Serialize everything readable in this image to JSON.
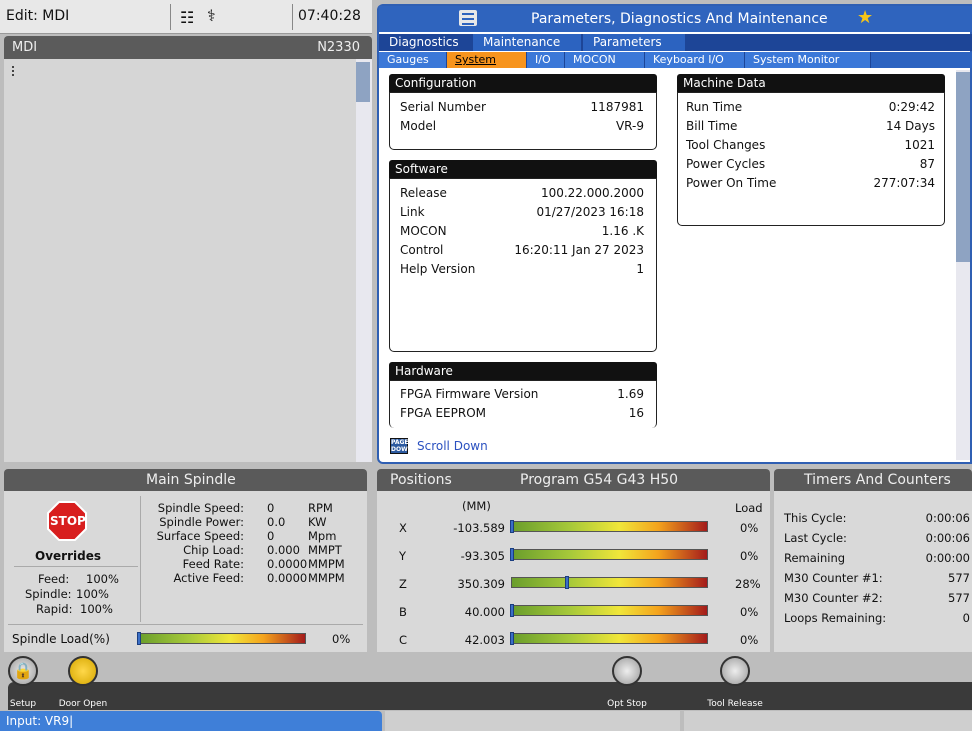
{
  "topbar": {
    "mode": "Edit: MDI",
    "clock": "07:40:28"
  },
  "mdi": {
    "title": "MDI",
    "n_number": "N2330"
  },
  "param": {
    "title": "Parameters, Diagnostics And Maintenance",
    "tabs1": [
      "Diagnostics",
      "Maintenance",
      "Parameters"
    ],
    "tabs2": [
      "Gauges",
      "System",
      "I/O",
      "MOCON",
      "Keyboard I/O",
      "System Monitor"
    ],
    "configuration": {
      "header": "Configuration",
      "rows": [
        {
          "label": "Serial Number",
          "value": "1187981"
        },
        {
          "label": "Model",
          "value": "VR-9"
        }
      ]
    },
    "software": {
      "header": "Software",
      "rows": [
        {
          "label": "Release",
          "value": "100.22.000.2000"
        },
        {
          "label": "Link",
          "value": "01/27/2023 16:18"
        },
        {
          "label": "MOCON",
          "value": "1.16  .K"
        },
        {
          "label": "Control",
          "value": "16:20:11  Jan 27 2023"
        },
        {
          "label": "Help Version",
          "value": "1"
        }
      ]
    },
    "hardware": {
      "header": "Hardware",
      "rows": [
        {
          "label": "FPGA Firmware Version",
          "value": "1.69"
        },
        {
          "label": "FPGA EEPROM",
          "value": "16"
        }
      ]
    },
    "machine_data": {
      "header": "Machine Data",
      "rows": [
        {
          "label": "Run Time",
          "value": "0:29:42"
        },
        {
          "label": "Bill Time",
          "value": "14 Days"
        },
        {
          "label": "Tool Changes",
          "value": "1021"
        },
        {
          "label": "Power Cycles",
          "value": "87"
        },
        {
          "label": "Power On Time",
          "value": "277:07:34"
        }
      ]
    },
    "page_icon": "PAGE DOWN",
    "scroll_down": "Scroll Down"
  },
  "spindle": {
    "title": "Main Spindle",
    "stop": "STOP",
    "overrides": "Overrides",
    "override_rows": [
      {
        "label": "Feed:",
        "value": "100%"
      },
      {
        "label": "Spindle:",
        "value": "100%"
      },
      {
        "label": "Rapid:",
        "value": "100%"
      }
    ],
    "params": [
      {
        "label": "Spindle Speed:",
        "value": "0",
        "unit": "RPM"
      },
      {
        "label": "Spindle Power:",
        "value": "0.0",
        "unit": "KW"
      },
      {
        "label": "Surface Speed:",
        "value": "0",
        "unit": "Mpm"
      },
      {
        "label": "Chip Load:",
        "value": "0.000",
        "unit": "MMPT"
      },
      {
        "label": "Feed Rate:",
        "value": "0.0000",
        "unit": "MMPM"
      },
      {
        "label": "Active Feed:",
        "value": "0.0000",
        "unit": "MMPM"
      }
    ],
    "load_label": "Spindle Load(%)",
    "load_value": "0%",
    "load_fraction": 0.0
  },
  "positions": {
    "title": "Positions",
    "program": "Program G54 G43 H50",
    "unit": "(MM)",
    "load_header": "Load",
    "axes": [
      {
        "axis": "X",
        "value": "-103.589",
        "load": "0%",
        "load_fraction": 0.0
      },
      {
        "axis": "Y",
        "value": "-93.305",
        "load": "0%",
        "load_fraction": 0.0
      },
      {
        "axis": "Z",
        "value": "350.309",
        "load": "28%",
        "load_fraction": 0.28
      },
      {
        "axis": "B",
        "value": "40.000",
        "load": "0%",
        "load_fraction": 0.0
      },
      {
        "axis": "C",
        "value": "42.003",
        "load": "0%",
        "load_fraction": 0.0
      }
    ]
  },
  "timers": {
    "title": "Timers And Counters",
    "rows": [
      {
        "label": "This Cycle:",
        "value": "0:00:06"
      },
      {
        "label": "Last Cycle:",
        "value": "0:00:06"
      },
      {
        "label": "Remaining",
        "value": "0:00:00"
      },
      {
        "label": "M30 Counter #1:",
        "value": "577"
      },
      {
        "label": "M30 Counter #2:",
        "value": "577"
      },
      {
        "label": "Loops Remaining:",
        "value": "0"
      }
    ]
  },
  "toolbar": {
    "setup": "Setup",
    "door_open": "Door Open",
    "opt_stop": "Opt Stop",
    "tool_release": "Tool Release"
  },
  "input": {
    "text": "Input:   VR9|"
  },
  "colors": {
    "accent": "#2f64be",
    "selected_tab": "#f7941d",
    "stop": "#d81e1e"
  }
}
